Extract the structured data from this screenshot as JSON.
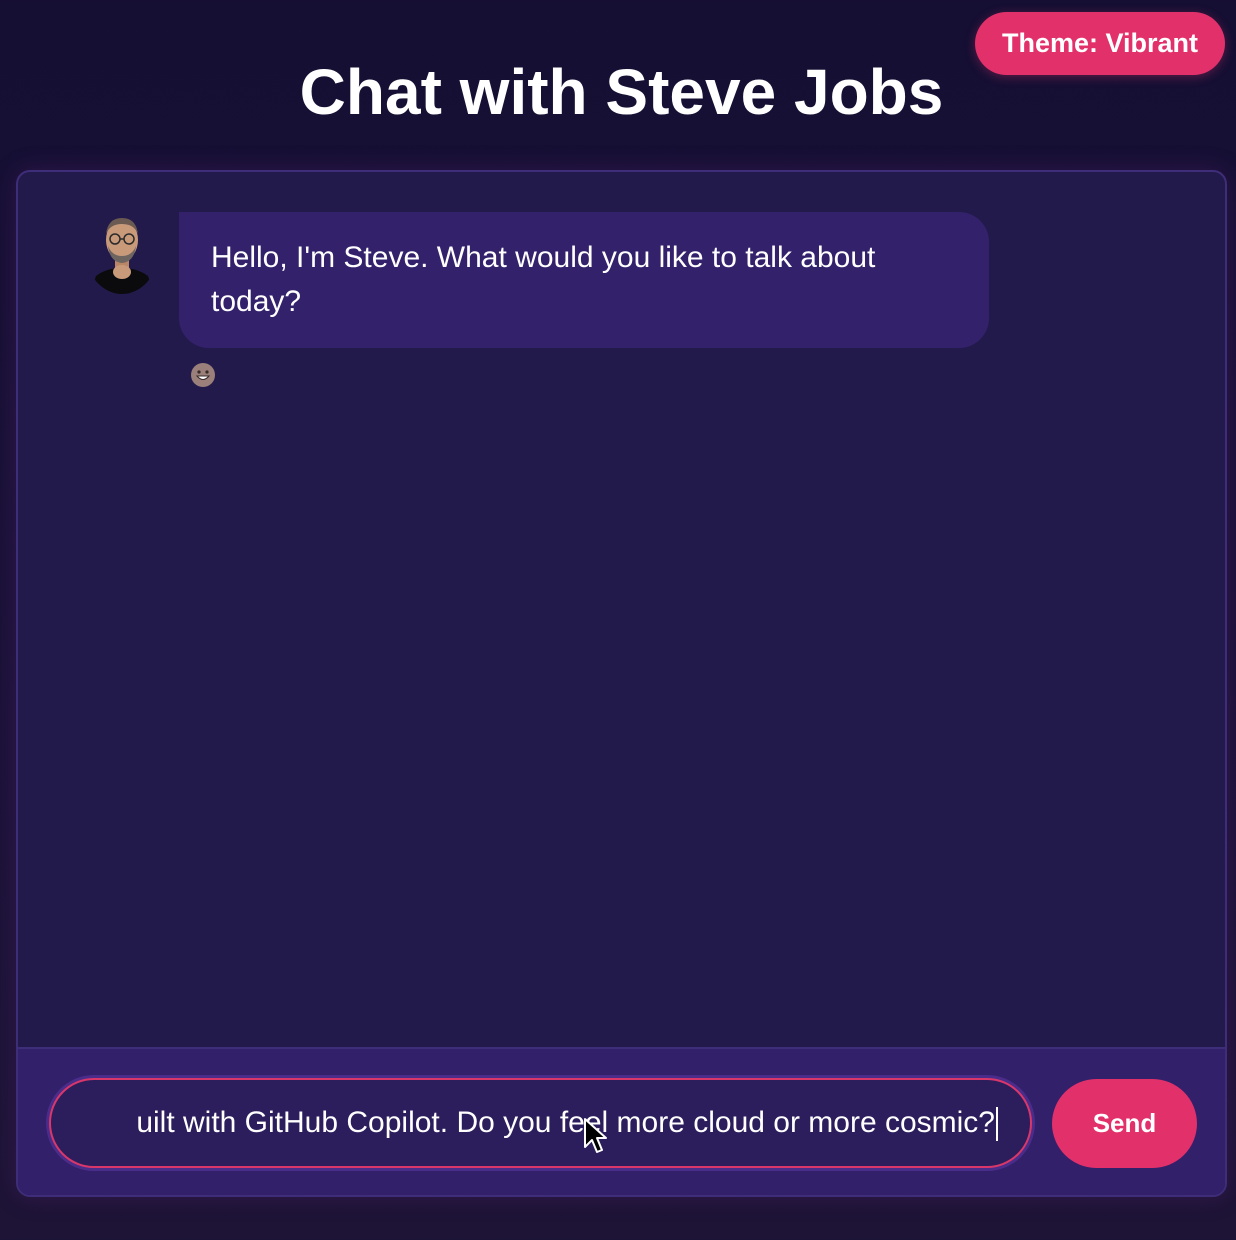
{
  "header": {
    "title": "Chat with Steve Jobs",
    "theme_button_label": "Theme: Vibrant"
  },
  "messages": [
    {
      "sender": "Steve",
      "avatar": "steve-jobs-portrait",
      "text": "Hello, I'm Steve. What would you like to talk about today?",
      "reaction_icon": "grinning-face-emoji"
    }
  ],
  "composer": {
    "input_value": "uilt with GitHub Copilot. Do you feel more cloud or more cosmic?",
    "send_label": "Send"
  },
  "colors": {
    "background": "#150f33",
    "panel": "#231a4c",
    "bubble": "#33216c",
    "input_bar": "#32206a",
    "accent": "#e2306b",
    "border": "#3e2d78"
  }
}
